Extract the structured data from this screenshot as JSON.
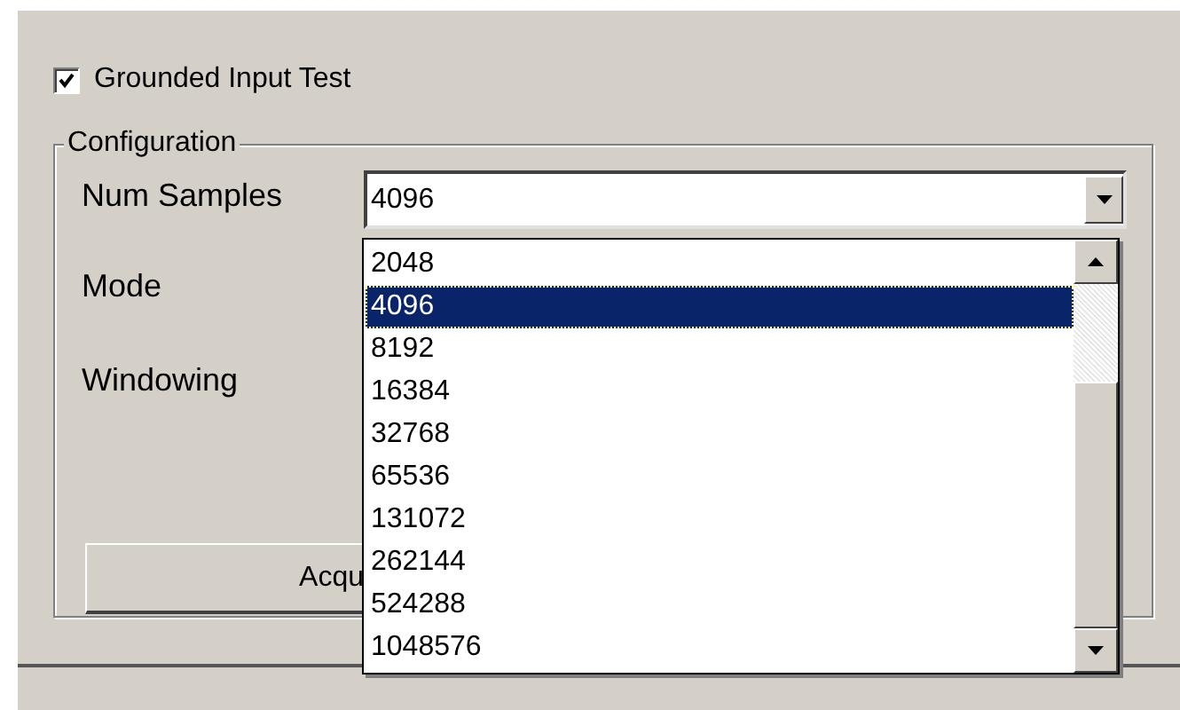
{
  "grounded_input_test": {
    "label": "Grounded Input Test",
    "checked": true
  },
  "configuration": {
    "title": "Configuration",
    "num_samples": {
      "label": "Num Samples",
      "value": "4096",
      "expanded": true,
      "options": [
        {
          "label": "2048",
          "selected": false
        },
        {
          "label": "4096",
          "selected": true
        },
        {
          "label": "8192",
          "selected": false
        },
        {
          "label": "16384",
          "selected": false
        },
        {
          "label": "32768",
          "selected": false
        },
        {
          "label": "65536",
          "selected": false
        },
        {
          "label": "131072",
          "selected": false
        },
        {
          "label": "262144",
          "selected": false
        },
        {
          "label": "524288",
          "selected": false
        },
        {
          "label": "1048576",
          "selected": false
        }
      ]
    },
    "mode": {
      "label": "Mode"
    },
    "windowing": {
      "label": "Windowing"
    },
    "acquire_button": {
      "label": "Acqu"
    }
  }
}
